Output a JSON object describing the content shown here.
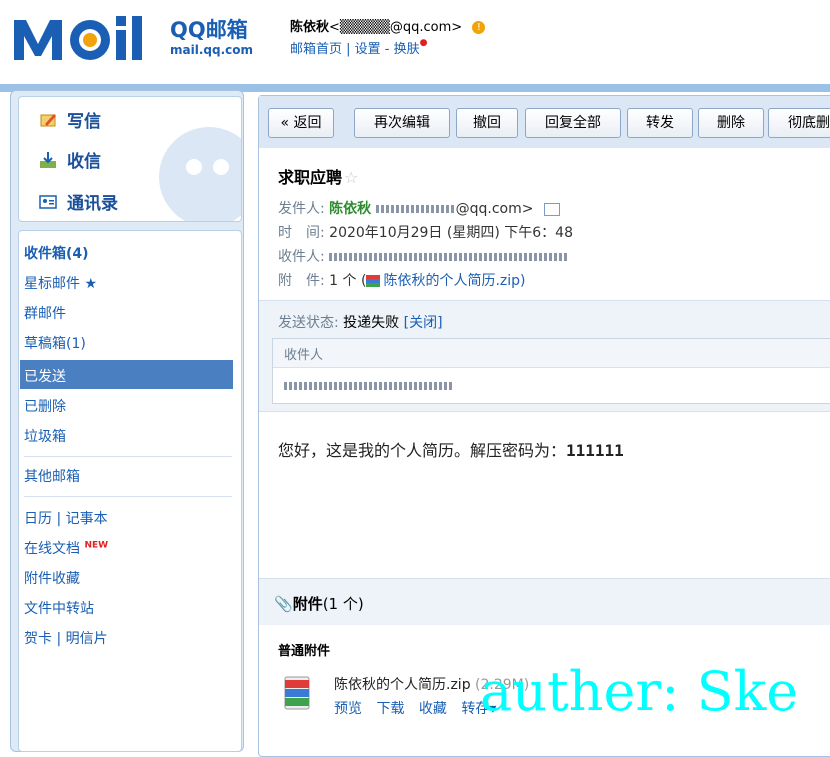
{
  "header": {
    "logo_brand": "QQ邮箱",
    "logo_domain": "mail.qq.com",
    "user_name": "陈依秋",
    "user_email": "<▒▒▒▒▒@qq.com>",
    "warn_symbol": "!",
    "links": "邮箱首页 | 设置 - 换肤",
    "skin_dot": "●"
  },
  "sidebar": {
    "compose": "写信",
    "inbox_receive": "收信",
    "contacts": "通讯录",
    "folders": [
      {
        "label": "收件箱(4)"
      },
      {
        "label": "星标邮件 ★"
      },
      {
        "label": "群邮件"
      },
      {
        "label": "草稿箱(1)"
      },
      {
        "label": "已发送"
      },
      {
        "label": "已删除"
      },
      {
        "label": "垃圾箱"
      },
      {
        "label": "其他邮箱"
      },
      {
        "label": "日历 | 记事本"
      },
      {
        "label": "在线文档"
      },
      {
        "label": "附件收藏"
      },
      {
        "label": "文件中转站"
      },
      {
        "label": "贺卡 | 明信片"
      }
    ],
    "new_badge": "NEW",
    "selected": "已发送"
  },
  "toolbar": {
    "back": "« 返回",
    "edit_again": "再次编辑",
    "recall": "撤回",
    "reply_all": "回复全部",
    "forward": "转发",
    "delete": "删除",
    "delete_perm": "彻底删"
  },
  "mail": {
    "subject": "求职应聘",
    "star": "☆",
    "from_label": "发件人:",
    "from_name": "陈依秋",
    "from_email": "@qq.com>",
    "time_label": "时　间:",
    "time_value": "2020年10月29日 (星期四) 下午6：48",
    "to_label": "收件人:",
    "att_label": "附　件:",
    "att_value": "1 个 (",
    "att_file": "陈依秋的个人简历.zip)",
    "status_label": "发送状态:",
    "status_value": "投递失败",
    "status_close": "[关闭]",
    "recipient_col": "收件人",
    "body_prefix": "您好，这是我的个人简历。解压密码为：",
    "body_code": "111111"
  },
  "attachments": {
    "title": "附件",
    "count": "(1 个)",
    "section": "普通附件",
    "file_name": "陈依秋的个人简历.zip",
    "file_size": "(2.29M)",
    "actions": [
      "预览",
      "下载",
      "收藏",
      "转存▾"
    ]
  },
  "watermark": "auther: Ske",
  "colors": {
    "accent": "#1a5fb4",
    "selected": "#4a7fc1",
    "band": "#9cc1e6"
  }
}
